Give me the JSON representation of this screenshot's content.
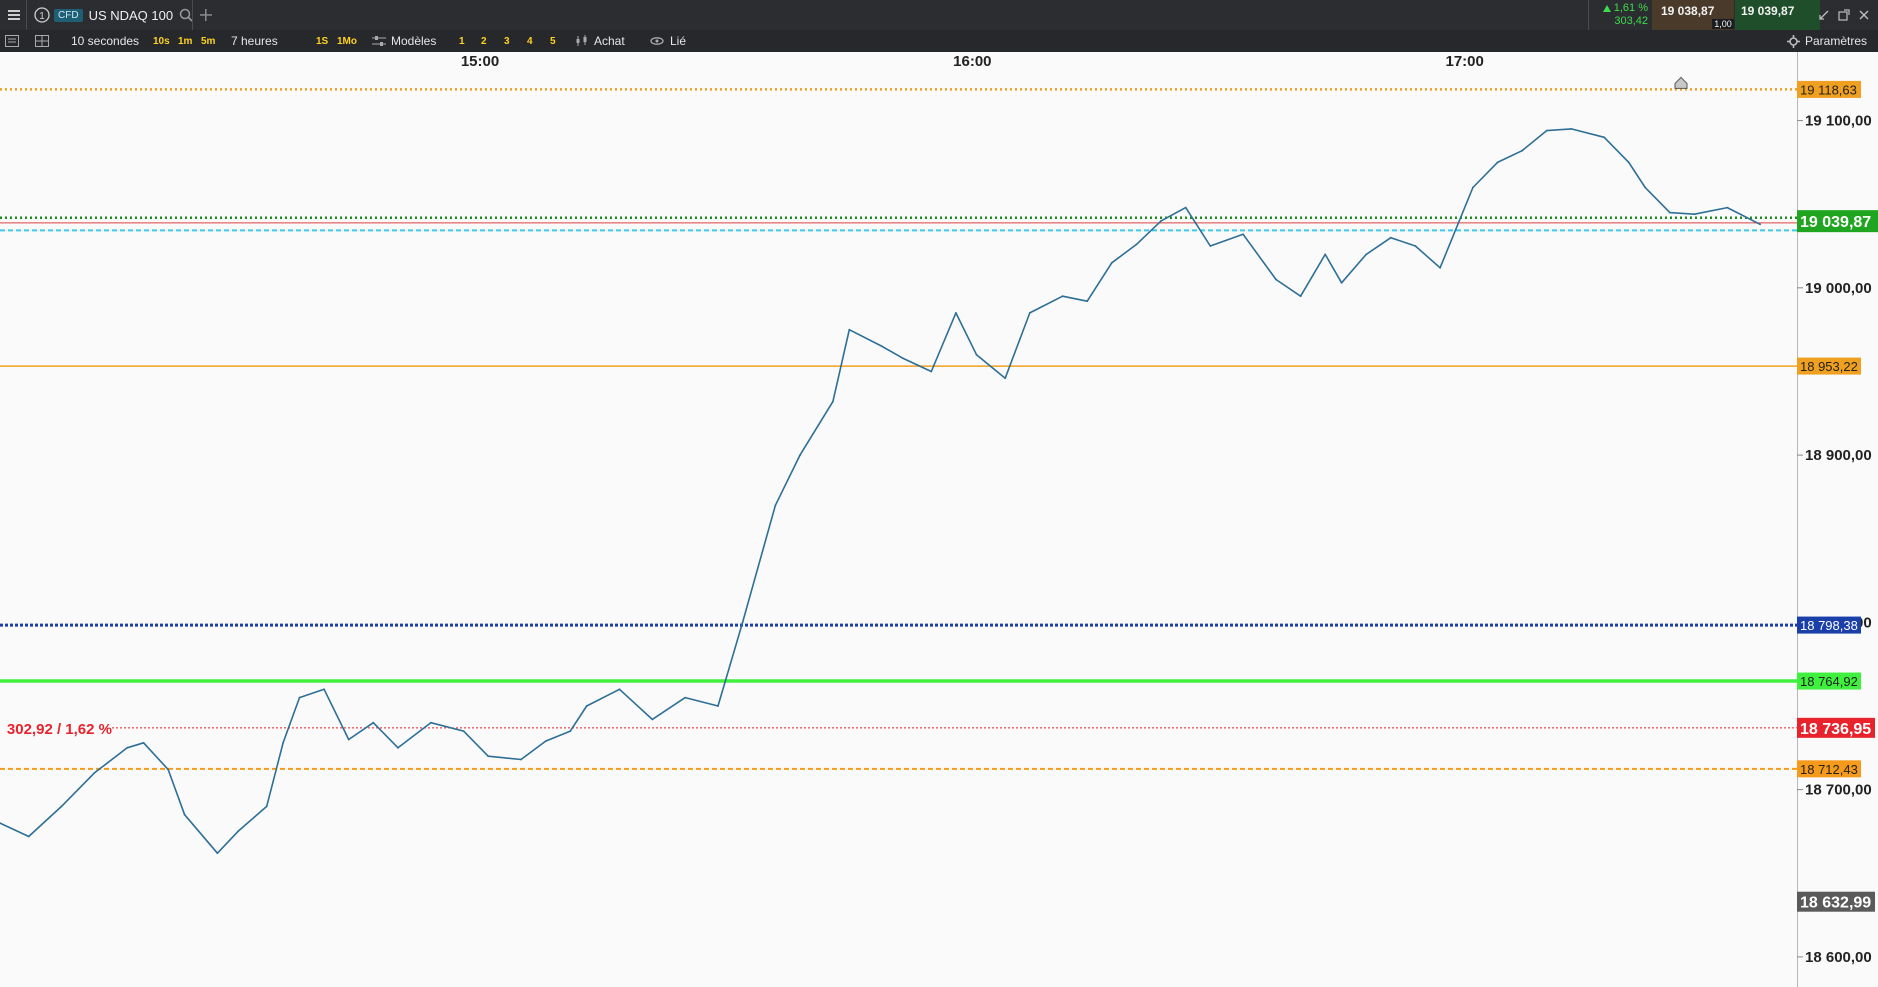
{
  "app": {
    "menu_icon": "hamburger-menu-icon",
    "info_icon": "info-circle-icon",
    "instrument_type": "CFD",
    "instrument_name": "US NDAQ 100",
    "search_icon": "search-icon",
    "add_tab_icon": "plus-icon"
  },
  "quote": {
    "change_pct": "1,61 %",
    "change_abs": "303,42",
    "sell_price": "19 038,87",
    "spread": "1,00",
    "buy_price": "19 039,87",
    "up_color": "#3ddc4a"
  },
  "window_controls": [
    "collapse-icon",
    "popout-icon",
    "close-icon"
  ],
  "toolbar": {
    "interval": "10 secondes",
    "quick_intervals": [
      "10s",
      "1m",
      "5m"
    ],
    "range": "7 heures",
    "range_buttons": [
      "1S",
      "1Mo"
    ],
    "templates_label": "Modèles",
    "slots": [
      "1",
      "2",
      "3",
      "4",
      "5"
    ],
    "buy_label": "Achat",
    "link_label": "Lié",
    "settings_label": "Paramètres"
  },
  "chart_data": {
    "type": "line",
    "instrument": "US NDAQ 100",
    "x_ticks": [
      "15:00",
      "16:00",
      "17:00"
    ],
    "x_tick_minutes": [
      900,
      960,
      1020
    ],
    "x_range_minutes": [
      841.5,
      1060.5
    ],
    "ylim": [
      18582,
      19141
    ],
    "y_ticks": [
      {
        "value": 19100,
        "label": "19 100,00"
      },
      {
        "value": 19000,
        "label": "19 000,00"
      },
      {
        "value": 18900,
        "label": "18 900,00"
      },
      {
        "value": 18800,
        "label": "18 800,00"
      },
      {
        "value": 18700,
        "label": "18 700,00"
      },
      {
        "value": 18600,
        "label": "18 600,00"
      }
    ],
    "current_price": {
      "value": 19039.87,
      "label": "19 039,87",
      "color": "#1fa51f"
    },
    "levels": [
      {
        "value": 19118.63,
        "label": "19 118,63",
        "color": "#f0a020",
        "style": "dotted"
      },
      {
        "value": 19041.87,
        "label": "",
        "color": "#1f8a1f",
        "style": "dotted"
      },
      {
        "value": 19038.87,
        "label": "",
        "color": "#e04040",
        "style": "solid-thin"
      },
      {
        "value": 19034.32,
        "label": "",
        "color": "#3ec8e8",
        "style": "dashed"
      },
      {
        "value": 18953.22,
        "label": "18 953,22",
        "color": "#f0a020",
        "style": "solid"
      },
      {
        "value": 18798.38,
        "label": "18 798,38",
        "color": "#1a3fa8",
        "style": "dotted-thick"
      },
      {
        "value": 18764.92,
        "label": "18 764,92",
        "color": "#3ff03f",
        "style": "solid-thick"
      },
      {
        "value": 18736.95,
        "label": "18 736,95",
        "color": "#e8232b",
        "style": "dotted-thin"
      },
      {
        "value": 18712.43,
        "label": "18 712,43",
        "color": "#f59a1a",
        "style": "dashed"
      },
      {
        "value": 18632.99,
        "label": "18 632,99",
        "color": "#5a5a5a",
        "style": "marker"
      }
    ],
    "change_label": "302,92 / 1,62 %",
    "series": [
      {
        "color": "#2d6f96",
        "x": [
          841.5,
          845,
          849,
          853,
          857,
          859,
          862,
          864,
          868,
          870.5,
          874,
          876,
          878,
          881,
          884,
          887,
          890,
          894,
          898,
          901,
          905,
          908,
          911,
          913,
          917,
          921,
          925,
          929,
          932,
          936,
          939,
          943,
          945,
          949,
          951.5,
          955,
          958,
          960.5,
          964,
          967,
          971,
          974,
          977,
          980,
          983,
          986,
          989,
          993,
          997,
          1000,
          1003,
          1005,
          1008,
          1011,
          1014,
          1017,
          1021,
          1024,
          1027,
          1030,
          1033,
          1037,
          1040,
          1042,
          1045,
          1048,
          1052,
          1056
        ],
        "y": [
          18680,
          18672,
          18690,
          18710,
          18725,
          18728,
          18712,
          18685,
          18662,
          18675,
          18690,
          18728,
          18755,
          18760,
          18730,
          18740,
          18725,
          18740,
          18735,
          18720,
          18718,
          18729,
          18735,
          18750,
          18760,
          18742,
          18755,
          18750,
          18800,
          18870,
          18900,
          18932,
          18975,
          18965,
          18958,
          18950,
          18985,
          18960,
          18946,
          18985,
          18995,
          18992,
          19015,
          19026,
          19040,
          19048,
          19025,
          19032,
          19005,
          18995,
          19020,
          19003,
          19020,
          19030,
          19025,
          19012,
          19060,
          19075,
          19082,
          19094,
          19095,
          19090,
          19075,
          19060,
          19045,
          19044,
          19048,
          19038
        ]
      }
    ],
    "legend": "none",
    "grid": false
  }
}
